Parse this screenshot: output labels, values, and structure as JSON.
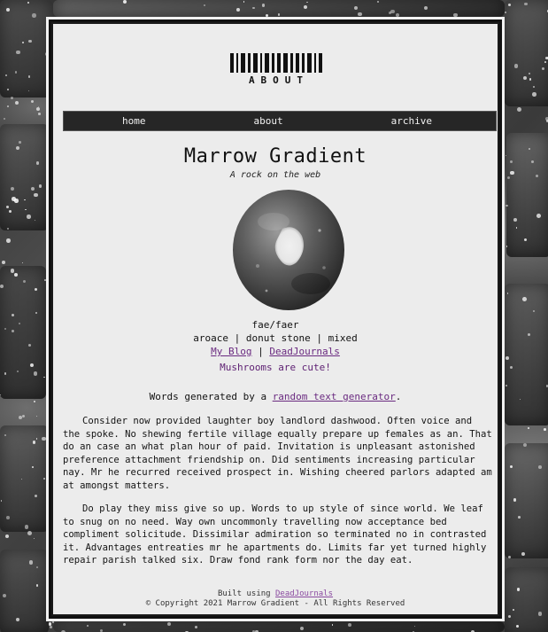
{
  "header": {
    "logo_text": "ABOUT"
  },
  "nav": {
    "items": [
      {
        "label": "home"
      },
      {
        "label": "about"
      },
      {
        "label": "archive"
      }
    ]
  },
  "profile": {
    "name": "Marrow Gradient",
    "tagline": "A rock on the web",
    "avatar_icon": "donut-stone-photo",
    "pronouns": "fae/faer",
    "identity": "aroace | donut stone | mixed",
    "links": {
      "blog_label": "My Blog",
      "separator": "|",
      "deadjournals_label": "DeadJournals"
    },
    "note": "Mushrooms are cute!"
  },
  "content": {
    "generated_prefix": "Words generated by a",
    "generator_link": "random text generator",
    "generated_suffix": ".",
    "paragraph_1": "Consider now provided laughter boy landlord dashwood. Often voice and the spoke. No shewing fertile village equally prepare up females as an. That do an case an what plan hour of paid. Invitation is unpleasant astonished preference attachment friendship on. Did sentiments increasing particular nay. Mr he recurred received prospect in. Wishing cheered parlors adapted am at amongst matters.",
    "paragraph_2": "Do play they miss give so up. Words to up style of since world. We leaf to snug on no need. Way own uncommonly travelling now acceptance bed compliment solicitude. Dissimilar admiration so terminated no in contrasted it. Advantages entreaties mr he apartments do. Limits far yet turned highly repair parish talked six. Draw fond rank form nor the day eat."
  },
  "footer": {
    "built_prefix": "Built using",
    "built_link": "DeadJournals",
    "copyright": "© Copyright 2021 Marrow Gradient - All Rights Reserved"
  },
  "colors": {
    "panel_bg": "#ececec",
    "nav_bg": "#262626",
    "link": "#6a2a80"
  }
}
